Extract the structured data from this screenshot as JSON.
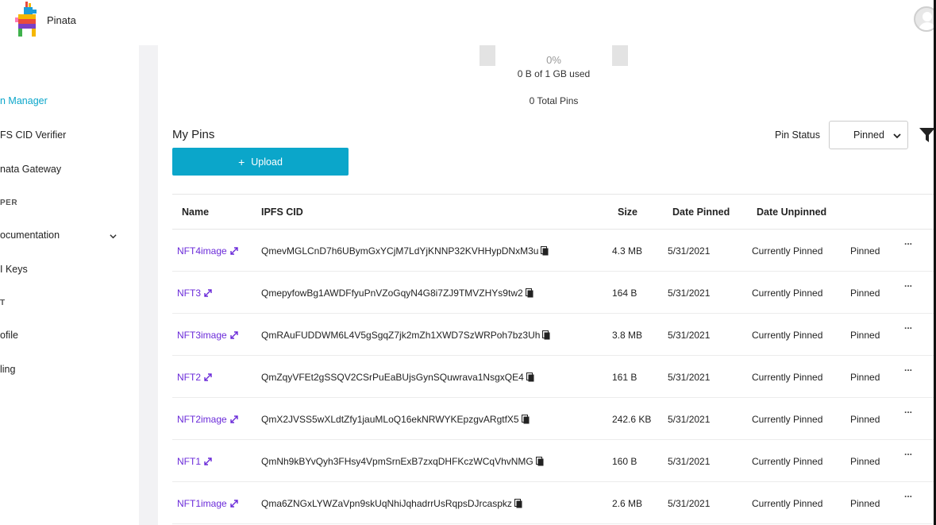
{
  "app": {
    "brand": "Pinata"
  },
  "sidebar": {
    "items": [
      {
        "label": "n Manager",
        "active": true
      },
      {
        "label": "FS CID Verifier"
      },
      {
        "label": "nata Gateway"
      },
      {
        "section": "PER"
      },
      {
        "label": "ocumentation",
        "expandable": true
      },
      {
        "label": "I Keys"
      },
      {
        "section": "T"
      },
      {
        "label": "ofile"
      },
      {
        "label": "ling"
      }
    ]
  },
  "usage": {
    "percent": "0%",
    "text": "0 B of 1 GB used",
    "total_pins": "0 Total Pins"
  },
  "pins": {
    "title": "My Pins",
    "upload_label": "Upload",
    "status_label": "Pin Status",
    "status_value": "Pinned",
    "columns": [
      "Name",
      "IPFS CID",
      "Size",
      "Date Pinned",
      "Date Unpinned"
    ],
    "rows": [
      {
        "name": "NFT4image",
        "cid": "QmevMGLCnD7h6UBymGxYCjM7LdYjKNNP32KVHHypDNxM3u",
        "size": "4.3 MB",
        "date_pinned": "5/31/2021",
        "date_unpinned": "Currently Pinned",
        "status": "Pinned",
        "menu": "..."
      },
      {
        "name": "NFT3",
        "cid": "QmepyfowBg1AWDFfyuPnVZoGqyN4G8i7ZJ9TMVZHYs9tw2",
        "size": "164 B",
        "date_pinned": "5/31/2021",
        "date_unpinned": "Currently Pinned",
        "status": "Pinned",
        "menu": "..."
      },
      {
        "name": "NFT3image",
        "cid": "QmRAuFUDDWM6L4V5gSgqZ7jk2mZh1XWD7SzWRPoh7bz3Uh",
        "size": "3.8 MB",
        "date_pinned": "5/31/2021",
        "date_unpinned": "Currently Pinned",
        "status": "Pinned",
        "menu": "..."
      },
      {
        "name": "NFT2",
        "cid": "QmZqyVFEt2gSSQV2CSrPuEaBUjsGynSQuwrava1NsgxQE4",
        "size": "161 B",
        "date_pinned": "5/31/2021",
        "date_unpinned": "Currently Pinned",
        "status": "Pinned",
        "menu": "..."
      },
      {
        "name": "NFT2image",
        "cid": "QmX2JVSS5wXLdtZfy1jauMLoQ16ekNRWYKEpzgvARgtfX5",
        "size": "242.6 KB",
        "date_pinned": "5/31/2021",
        "date_unpinned": "Currently Pinned",
        "status": "Pinned",
        "menu": "..."
      },
      {
        "name": "NFT1",
        "cid": "QmNh9kBYvQyh3FHsy4VpmSrnExB7zxqDHFKczWCqVhvNMG",
        "size": "160 B",
        "date_pinned": "5/31/2021",
        "date_unpinned": "Currently Pinned",
        "status": "Pinned",
        "menu": "..."
      },
      {
        "name": "NFT1image",
        "cid": "Qma6ZNGxLYWZaVpn9skUqNhiJqhadrrUsRqpsDJrcaspkz",
        "size": "2.6 MB",
        "date_pinned": "5/31/2021",
        "date_unpinned": "Currently Pinned",
        "status": "Pinned",
        "menu": "..."
      }
    ]
  },
  "colors": {
    "accent": "#0ba6ca",
    "link": "#6b2bd9"
  },
  "icons": {
    "external": "external-link-icon",
    "copy": "copy-icon",
    "filter": "filter-icon",
    "more": "more-icon"
  }
}
